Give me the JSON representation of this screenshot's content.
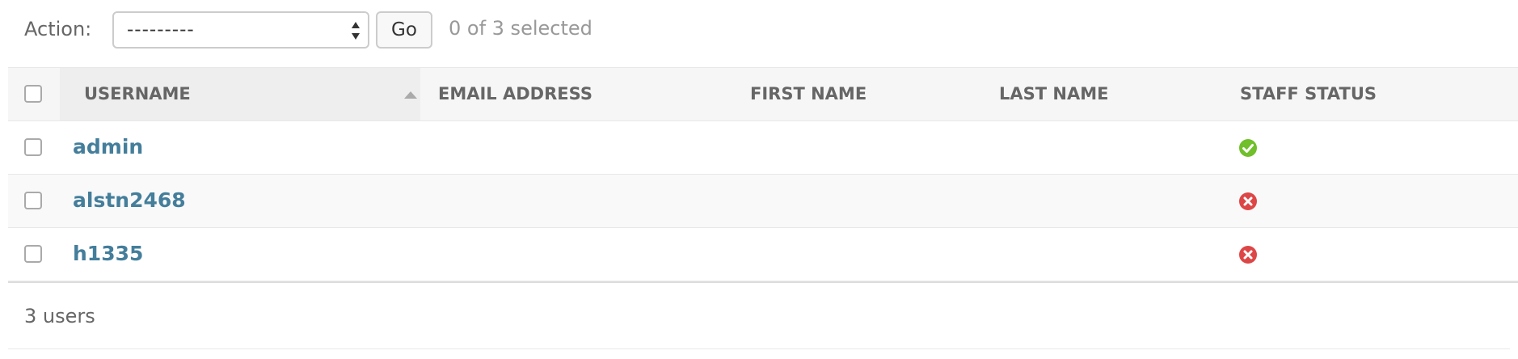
{
  "actions": {
    "label": "Action:",
    "select_value": "---------",
    "go_label": "Go",
    "selected_text": "0 of 3 selected"
  },
  "table": {
    "columns": [
      "Username",
      "Email address",
      "First name",
      "Last name",
      "Staff status"
    ],
    "sorted_column": "Username",
    "sort_direction": "ascending",
    "rows": [
      {
        "username": "admin",
        "email": "",
        "first_name": "",
        "last_name": "",
        "staff_status": "yes",
        "selected": false
      },
      {
        "username": "alstn2468",
        "email": "",
        "first_name": "",
        "last_name": "",
        "staff_status": "no",
        "selected": false
      },
      {
        "username": "h1335",
        "email": "",
        "first_name": "",
        "last_name": "",
        "staff_status": "no",
        "selected": false
      }
    ]
  },
  "paginator": {
    "text": "3 users"
  },
  "icons": {
    "staff_yes": "check-circle-icon",
    "staff_no": "x-circle-icon",
    "select_arrows": "up-down-arrows-icon",
    "sort": "sort-ascending-icon"
  },
  "colors": {
    "link": "#447e9b",
    "yes": "#70bf2b",
    "no": "#dd4646",
    "header_bg": "#f6f6f6"
  }
}
